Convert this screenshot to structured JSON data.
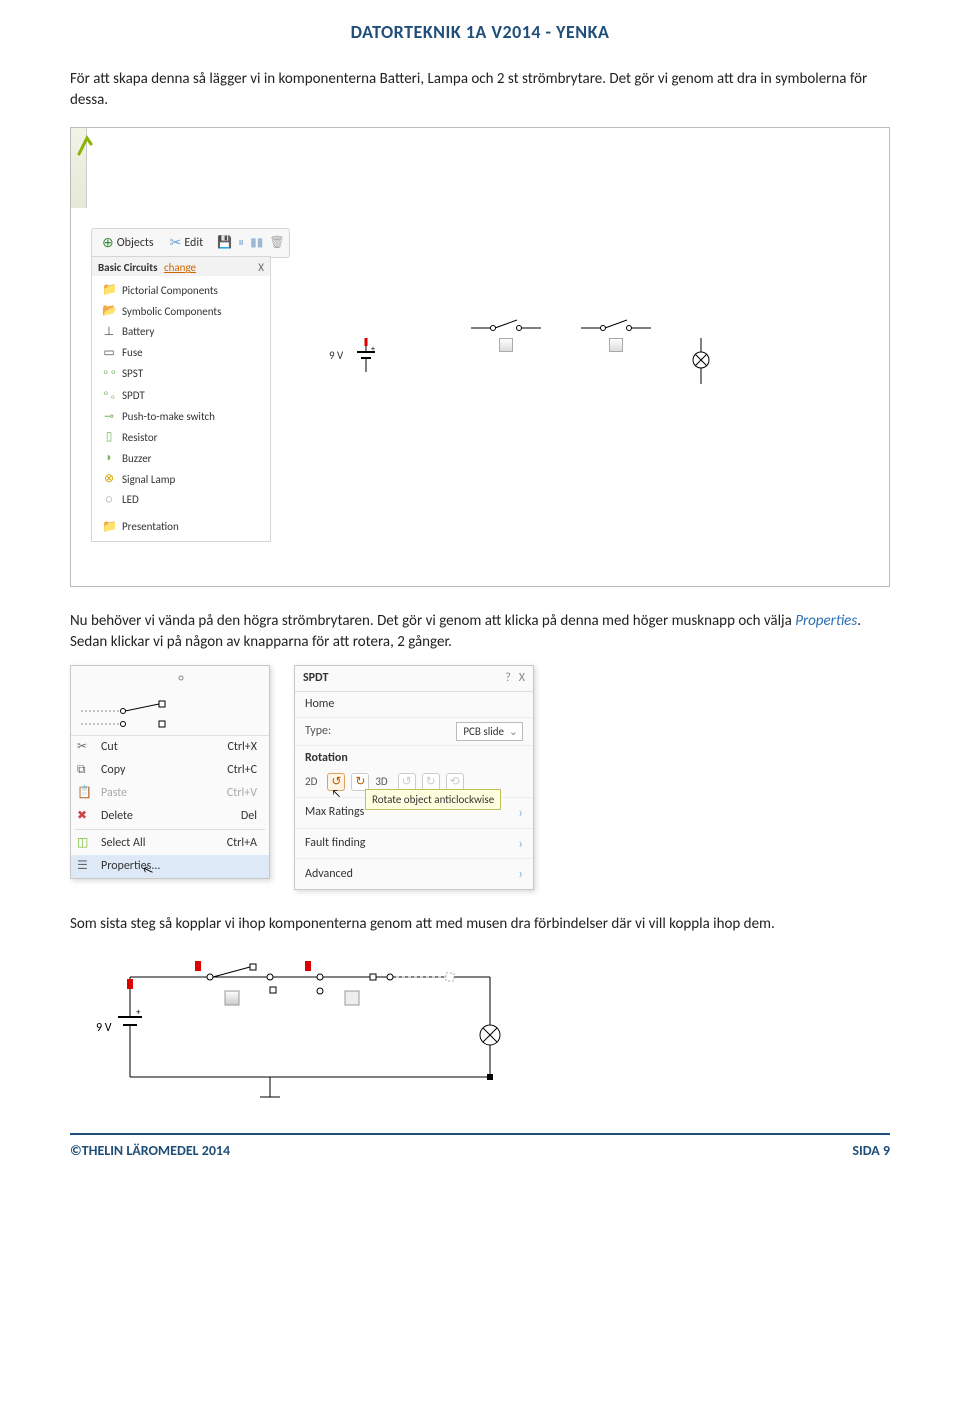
{
  "header": "DATORTEKNIK 1A V2014 - YENKA",
  "para1": "För att skapa denna så lägger vi in komponenterna Batteri, Lampa och 2 st strömbrytare. Det gör vi genom att dra in symbolerna för dessa.",
  "toolbar": {
    "objects": "Objects",
    "edit": "Edit"
  },
  "panel": {
    "title": "Basic Circuits",
    "change": "change"
  },
  "tree": {
    "pictorial": "Pictorial Components",
    "symbolic": "Symbolic Components",
    "battery": "Battery",
    "fuse": "Fuse",
    "spst": "SPST",
    "spdt": "SPDT",
    "push": "Push-to-make switch",
    "resistor": "Resistor",
    "buzzer": "Buzzer",
    "lamp": "Signal Lamp",
    "led": "LED",
    "presentation": "Presentation"
  },
  "battery_label": "9 V",
  "para2a": "Nu behöver vi vända på den högra strömbrytaren. Det gör vi genom att klicka på denna med höger musknapp och välja ",
  "para2_link": "Properties",
  "para2b": ". Sedan klickar vi på någon av knapparna för att rotera, 2 gånger.",
  "context_menu": {
    "cut": "Cut",
    "cut_k": "Ctrl+X",
    "copy": "Copy",
    "copy_k": "Ctrl+C",
    "paste": "Paste",
    "paste_k": "Ctrl+V",
    "delete": "Delete",
    "delete_k": "Del",
    "selectall": "Select All",
    "selectall_k": "Ctrl+A",
    "properties": "Properties..."
  },
  "prop": {
    "title": "SPDT",
    "home": "Home",
    "type_label": "Type:",
    "type_value": "PCB slide",
    "rotation": "Rotation",
    "two_d": "2D",
    "three_d": "3D",
    "tooltip": "Rotate object anticlockwise",
    "max": "Max Ratings",
    "fault": "Fault finding",
    "advanced": "Advanced"
  },
  "para3": "Som sista steg så kopplar vi ihop komponenterna genom att med musen dra förbindelser där vi vill koppla ihop dem.",
  "battery_label2": "9 V",
  "footer": {
    "left": "©THELIN LÄROMEDEL 2014",
    "right": "SIDA 9"
  }
}
